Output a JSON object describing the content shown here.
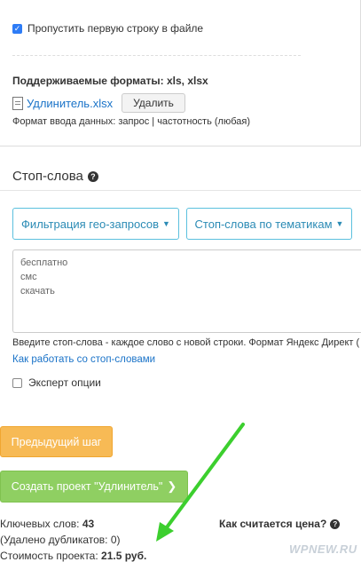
{
  "import": {
    "skip_first_row_label": "Пропустить первую строку в файле",
    "skip_first_row_checked": true,
    "formats_label": "Поддерживаемые форматы: xls, xlsx",
    "file_name": "Удлинитель.xlsx",
    "delete_label": "Удалить",
    "input_format": "Формат ввода данных: запрос | частотность (любая)"
  },
  "stopwords": {
    "title": "Стоп-слова",
    "geo_filter_label": "Фильтрация гео-запросов",
    "theme_label": "Стоп-слова по тематикам",
    "words": [
      "бесплатно",
      "смс",
      "скачать"
    ],
    "hint": "Введите стоп-слова - каждое слово с новой строки. Формат Яндекс Директ (",
    "how_link": "Как работать со стоп-словами",
    "expert_label": "Эксперт опции",
    "expert_checked": false
  },
  "actions": {
    "prev_label": "Предыдущий шаг",
    "create_label": "Создать проект \"Удлинитель\""
  },
  "summary": {
    "keywords_label": "Ключевых слов:",
    "keywords_value": "43",
    "duplicates": "(Удалено дубликатов: 0)",
    "cost_label": "Стоимость проекта:",
    "cost_value": "21.5 руб.",
    "price_question": "Как считается цена?"
  },
  "watermark": "WPNEW.RU",
  "colors": {
    "accent_blue": "#2e7cf6",
    "link": "#1a73c8",
    "dropdown_border": "#5bc0de",
    "prev_button": "#f7ba55",
    "create_button": "#8fcf62",
    "annotation_arrow": "#3ccf2e"
  },
  "icons": {
    "checkbox": "check-icon",
    "file": "excel-file-icon",
    "help": "question-circle-icon",
    "caret": "caret-down-icon",
    "next": "chevron-right-icon"
  }
}
